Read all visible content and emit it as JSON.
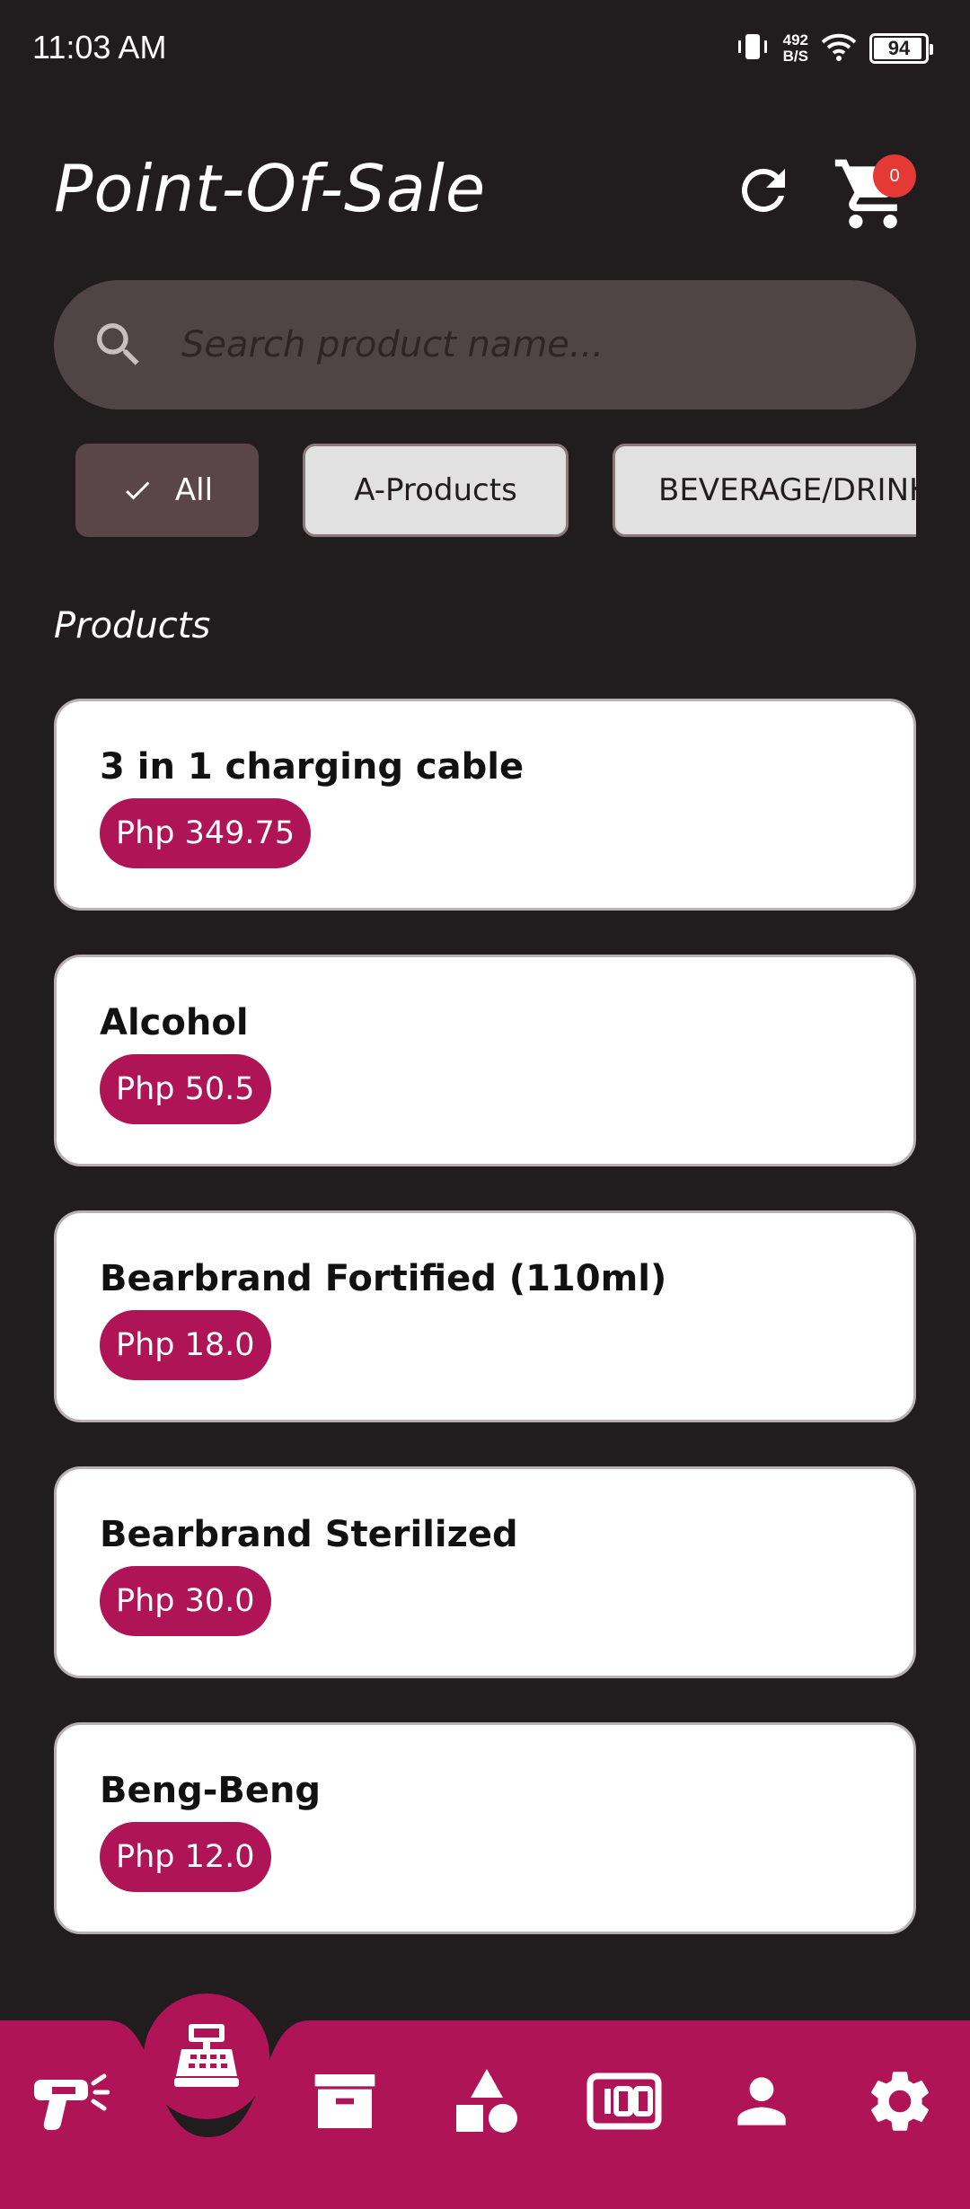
{
  "status_bar": {
    "time": "11:03 AM",
    "net_speed_value": "492",
    "net_speed_unit": "B/S",
    "battery_level": "94"
  },
  "header": {
    "title": "Point-Of-Sale",
    "cart_count": "0"
  },
  "search": {
    "placeholder": "Search product name..."
  },
  "filters": {
    "chips": [
      "All",
      "A-Products",
      "BEVERAGE/DRINK"
    ],
    "selected": "All"
  },
  "products_section": {
    "title": "Products"
  },
  "products": [
    {
      "name": "3 in 1 charging cable",
      "price": "Php 349.75"
    },
    {
      "name": "Alcohol",
      "price": "Php 50.5"
    },
    {
      "name": "Bearbrand Fortified (110ml)",
      "price": "Php 18.0"
    },
    {
      "name": "Bearbrand Sterilized",
      "price": "Php 30.0"
    },
    {
      "name": "Beng-Beng",
      "price": "Php 12.0"
    }
  ],
  "bottom_nav": {
    "items": [
      "scanner-icon",
      "cash-register-icon",
      "archive-box-icon",
      "shapes-icon",
      "counter-icon",
      "person-icon",
      "gear-icon"
    ],
    "active": "cash-register-icon"
  },
  "colors": {
    "background": "#211c1d",
    "accent": "#ae1456",
    "search_bg": "#4f4446",
    "chip_selected": "#5a4549",
    "badge": "#e53935"
  }
}
